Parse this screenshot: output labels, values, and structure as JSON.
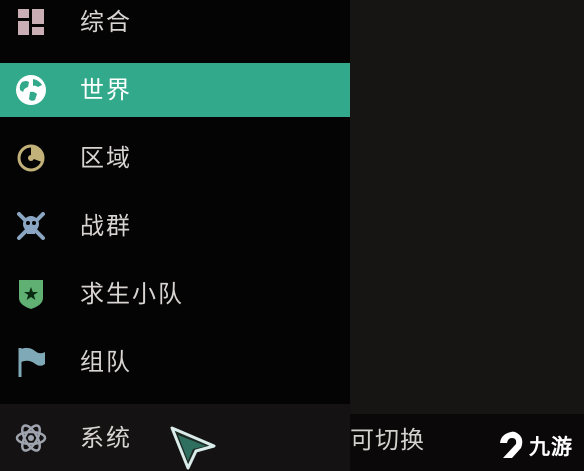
{
  "menu": {
    "items": [
      {
        "label": "综合",
        "icon": "dashboard-icon"
      },
      {
        "label": "世界",
        "icon": "globe-icon",
        "active": true
      },
      {
        "label": "区域",
        "icon": "radar-icon"
      },
      {
        "label": "战群",
        "icon": "skull-crossbones-icon"
      },
      {
        "label": "求生小队",
        "icon": "shield-star-icon"
      },
      {
        "label": "组队",
        "icon": "flag-icon"
      },
      {
        "label": "系统",
        "icon": "atom-icon"
      }
    ]
  },
  "hint": {
    "text": "可切换"
  },
  "watermark": {
    "text": "九游"
  },
  "colors": {
    "accent": "#33a98b",
    "sidebar_bg": "#050404",
    "text": "#d8d4d2"
  }
}
